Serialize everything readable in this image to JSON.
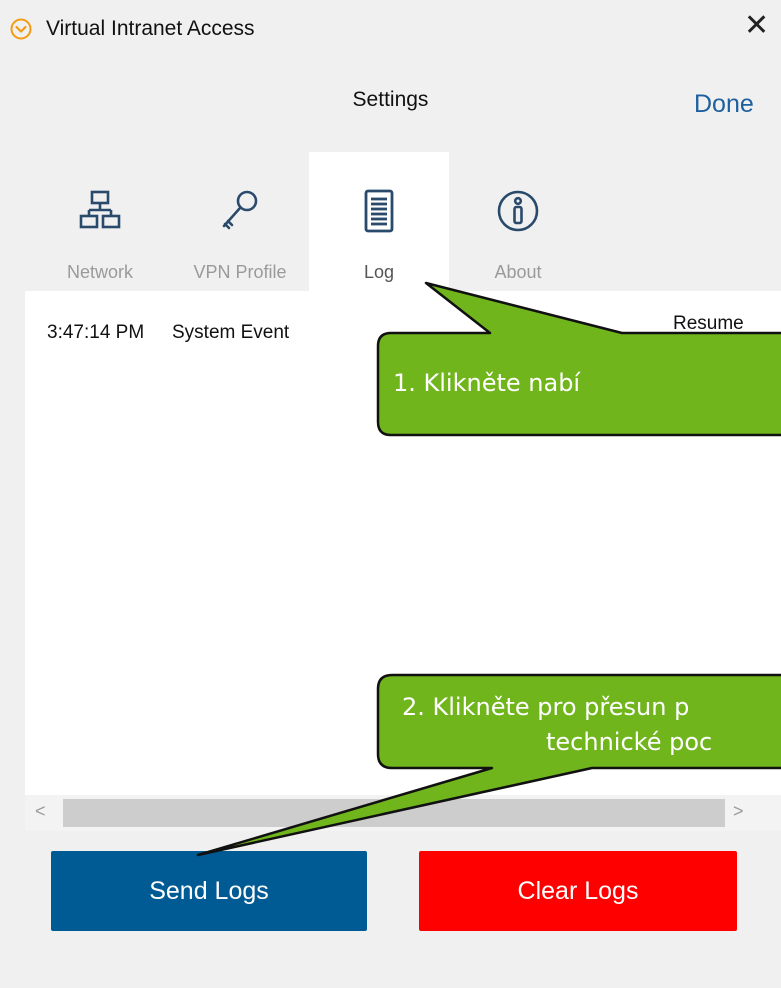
{
  "window": {
    "title": "Virtual Intranet Access",
    "close_glyph": "✕"
  },
  "header": {
    "title": "Settings",
    "done_label": "Done"
  },
  "tabs": [
    {
      "label": "Network",
      "icon": "network-icon",
      "active": false
    },
    {
      "label": "VPN Profile",
      "icon": "key-icon",
      "active": false
    },
    {
      "label": "Log",
      "icon": "log-document-icon",
      "active": true
    },
    {
      "label": "About",
      "icon": "info-icon",
      "active": false
    }
  ],
  "log": {
    "entries": [
      {
        "time": "3:47:14 PM",
        "type": "System Event",
        "message": "Resume"
      }
    ],
    "scroll_left_glyph": "<",
    "scroll_right_glyph": ">"
  },
  "buttons": {
    "send_logs": "Send Logs",
    "clear_logs": "Clear Logs"
  },
  "annotations": {
    "callout1": "1. Klikněte nabí",
    "callout2_line1": "2. Klikněte pro přesun p",
    "callout2_line2": "technické poc"
  },
  "colors": {
    "accent": "#1e5fa0",
    "send_button": "#005b94",
    "clear_button": "#ff0000",
    "callout_fill": "#71b51d",
    "app_icon": "#f39c12"
  }
}
